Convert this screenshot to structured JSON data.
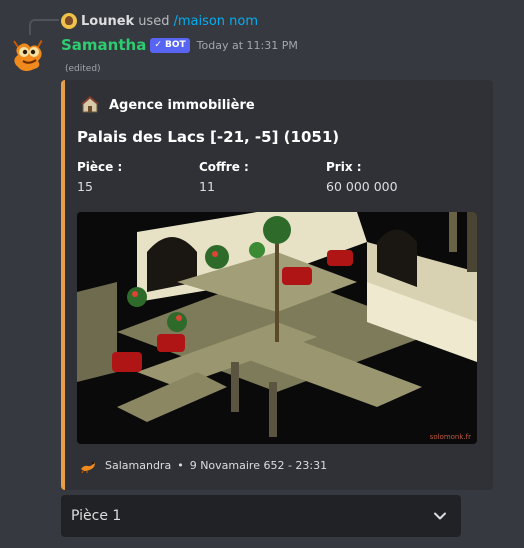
{
  "reply": {
    "username": "Lounek",
    "used_text": "used",
    "command": "/maison nom"
  },
  "message": {
    "username": "Samantha",
    "bot_badge": "✓ BOT",
    "timestamp": "Today at 11:31 PM",
    "edited": "(edited)"
  },
  "embed": {
    "accent_color": "#e79d4a",
    "author": "Agence immobilière",
    "title": "Palais des Lacs [-21, -5] (1051)",
    "fields": [
      {
        "name": "Pièce :",
        "value": "15"
      },
      {
        "name": "Coffre :",
        "value": "11"
      },
      {
        "name": "Prix :",
        "value": "60 000 000"
      }
    ],
    "image_watermark": "solomonk.fr",
    "footer": {
      "text": "Salamandra",
      "separator": "•",
      "date": "9 Novamaire 652 - 23:31"
    }
  },
  "select_menu": {
    "selected": "Pièce 1",
    "icon": "chevron-down-icon"
  }
}
